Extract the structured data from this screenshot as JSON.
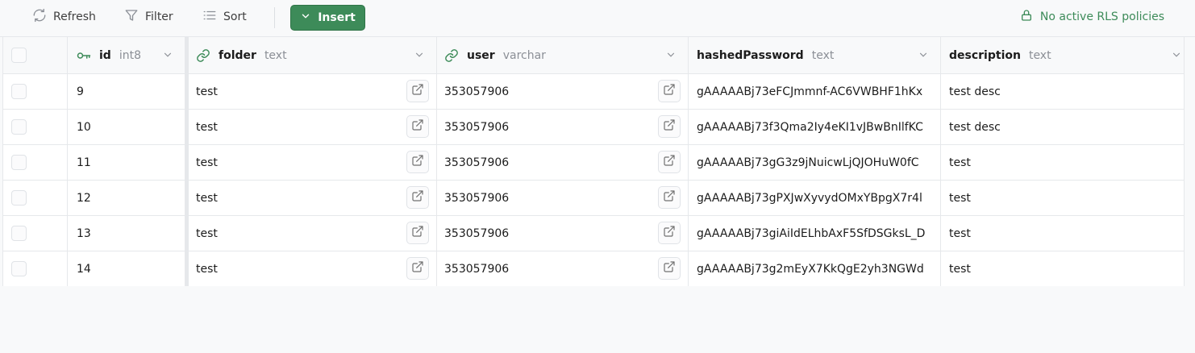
{
  "toolbar": {
    "refresh_label": "Refresh",
    "filter_label": "Filter",
    "sort_label": "Sort",
    "insert_label": "Insert",
    "rls_label": "No active RLS policies"
  },
  "colors": {
    "accent": "#3d8b59",
    "key_icon": "#3d8b59",
    "link_icon": "#3d8b59"
  },
  "table": {
    "columns": [
      {
        "name": "id",
        "type": "int8",
        "icon": "key-icon"
      },
      {
        "name": "folder",
        "type": "text",
        "icon": "link-icon"
      },
      {
        "name": "user",
        "type": "varchar",
        "icon": "link-icon"
      },
      {
        "name": "hashedPassword",
        "type": "text",
        "icon": ""
      },
      {
        "name": "description",
        "type": "text",
        "icon": ""
      }
    ],
    "rows": [
      {
        "id": "9",
        "folder": "test",
        "user": "353057906",
        "hashedPassword": "gAAAAABj73eFCJmmnf-AC6VWBHF1hKx",
        "description": "test desc"
      },
      {
        "id": "10",
        "folder": "test",
        "user": "353057906",
        "hashedPassword": "gAAAAABj73f3Qma2Iy4eKI1vJBwBnIlfKC",
        "description": "test desc"
      },
      {
        "id": "11",
        "folder": "test",
        "user": "353057906",
        "hashedPassword": "gAAAAABj73gG3z9jNuicwLjQJOHuW0fC",
        "description": "test"
      },
      {
        "id": "12",
        "folder": "test",
        "user": "353057906",
        "hashedPassword": "gAAAAABj73gPXJwXyvydOMxYBpgX7r4l",
        "description": "test"
      },
      {
        "id": "13",
        "folder": "test",
        "user": "353057906",
        "hashedPassword": "gAAAAABj73giAiIdELhbAxF5SfDSGksL_D",
        "description": "test"
      },
      {
        "id": "14",
        "folder": "test",
        "user": "353057906",
        "hashedPassword": "gAAAAABj73g2mEyX7KkQgE2yh3NGWd",
        "description": "test"
      }
    ]
  }
}
